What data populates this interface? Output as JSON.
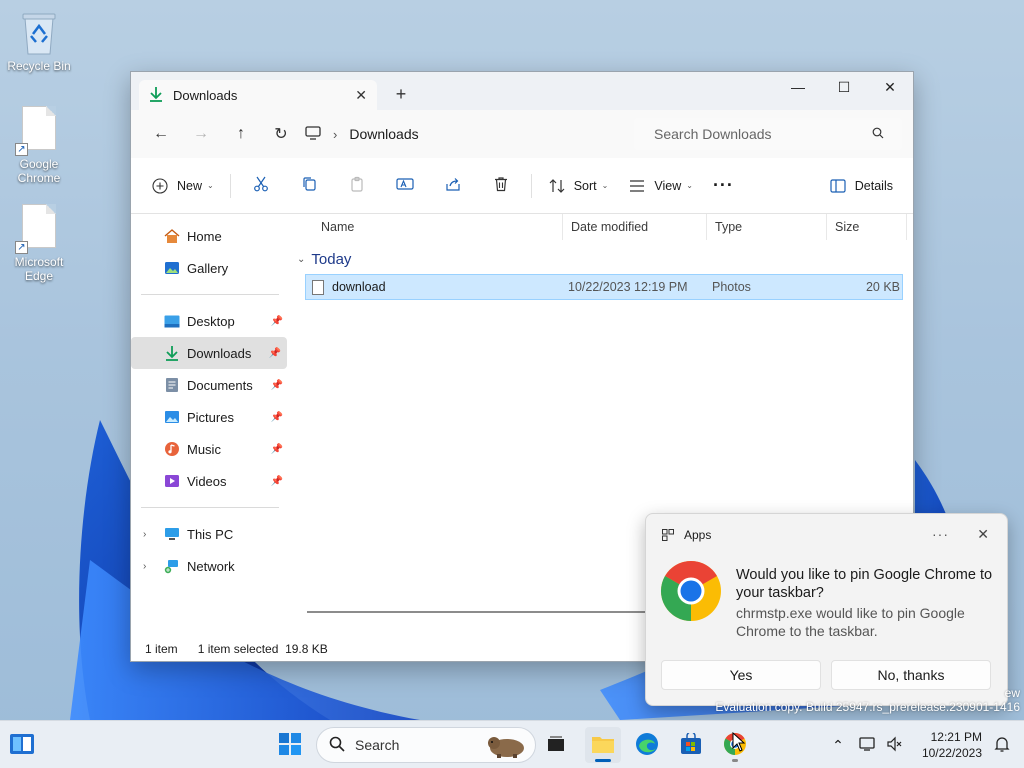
{
  "desktop": {
    "icons": [
      {
        "label": "Recycle Bin"
      },
      {
        "label": "Google Chrome"
      },
      {
        "label": "Microsoft Edge"
      }
    ]
  },
  "explorer": {
    "tab_title": "Downloads",
    "breadcrumb": "Downloads",
    "search_placeholder": "Search Downloads",
    "toolbar": {
      "new_label": "New",
      "sort_label": "Sort",
      "view_label": "View",
      "details_label": "Details"
    },
    "nav": {
      "home": "Home",
      "gallery": "Gallery",
      "desktop": "Desktop",
      "downloads": "Downloads",
      "documents": "Documents",
      "pictures": "Pictures",
      "music": "Music",
      "videos": "Videos",
      "this_pc": "This PC",
      "network": "Network"
    },
    "columns": {
      "name": "Name",
      "date": "Date modified",
      "type": "Type",
      "size": "Size"
    },
    "group": "Today",
    "files": [
      {
        "name": "download",
        "date": "10/22/2023 12:19 PM",
        "type": "Photos",
        "size": "20 KB"
      }
    ],
    "status": {
      "count": "1 item",
      "selected": "1 item selected  19.8 KB"
    }
  },
  "toast": {
    "app": "Apps",
    "title": "Would you like to pin Google Chrome to your taskbar?",
    "body": "chrmstp.exe would like to pin Google Chrome to the taskbar.",
    "yes": "Yes",
    "no": "No, thanks"
  },
  "watermark": {
    "line1": "ew",
    "line2": "Evaluation copy. Build 25947.rs_prerelease.230901-1416"
  },
  "taskbar": {
    "search_label": "Search",
    "time": "12:21 PM",
    "date": "10/22/2023"
  },
  "colors": {
    "accent": "#005fb8",
    "selection_bg": "#cde8ff",
    "download_green": "#0f9d58"
  }
}
